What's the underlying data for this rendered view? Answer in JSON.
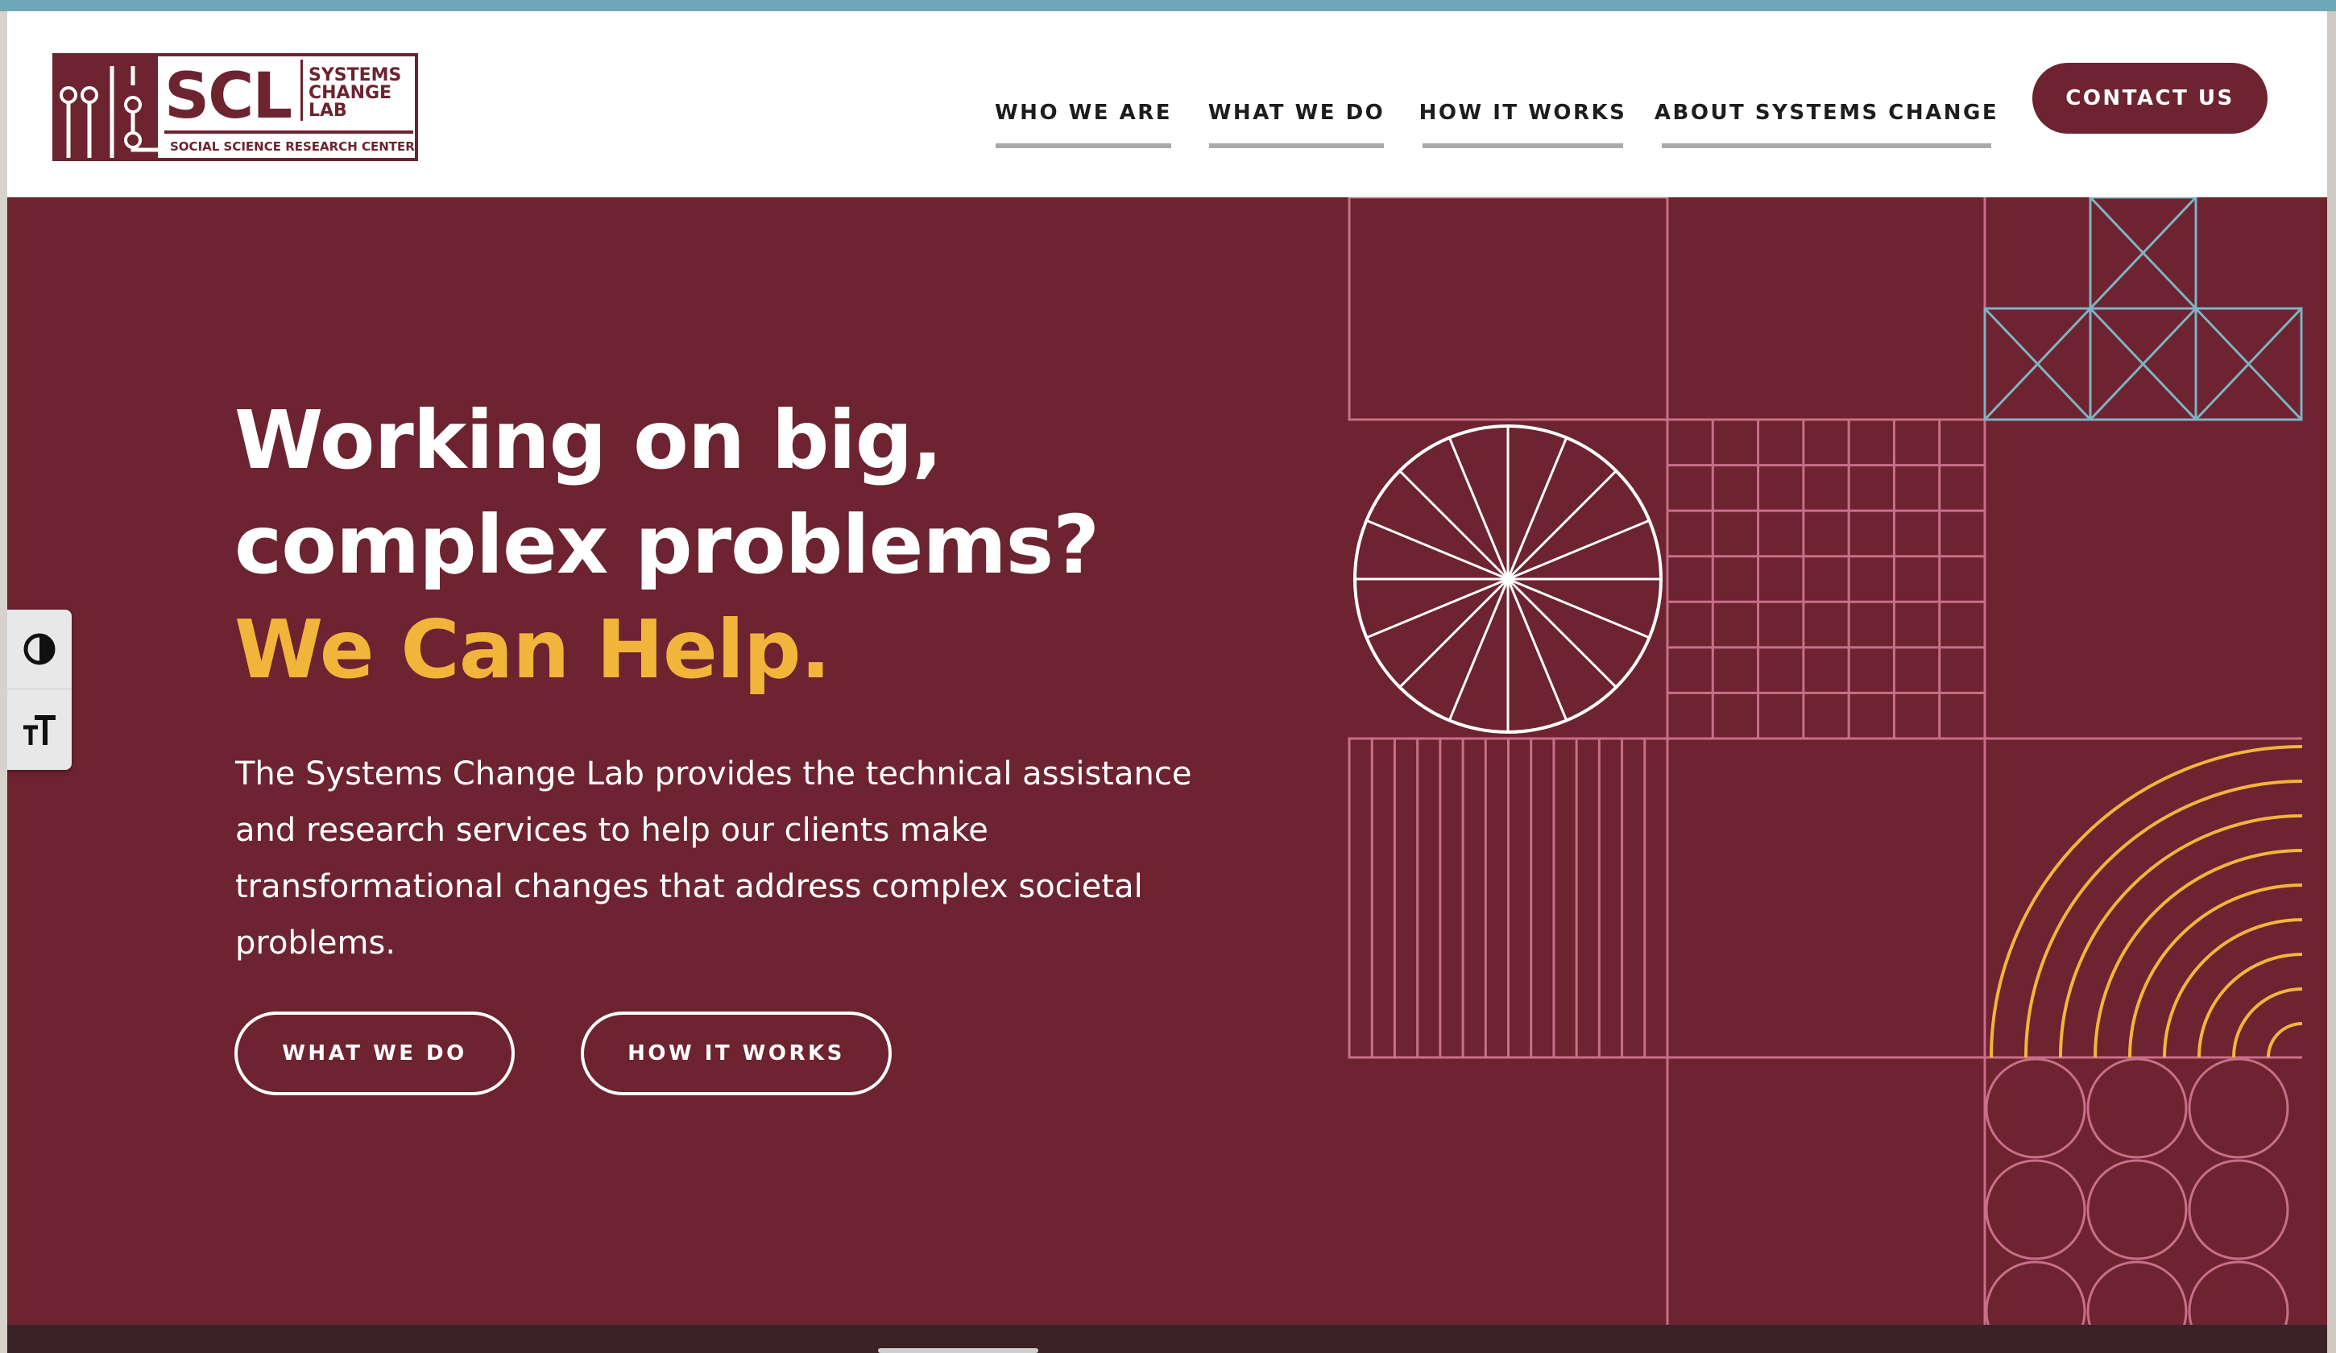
{
  "logo": {
    "wordmark": "SCL",
    "line1": "SYSTEMS",
    "line2": "CHANGE",
    "line3": "LAB",
    "subtitle": "SOCIAL SCIENCE RESEARCH CENTER"
  },
  "nav": {
    "items": [
      {
        "label": "WHO WE ARE"
      },
      {
        "label": "WHAT WE DO"
      },
      {
        "label": "HOW IT WORKS"
      },
      {
        "label": "ABOUT SYSTEMS CHANGE"
      }
    ],
    "contact_label": "CONTACT US"
  },
  "hero": {
    "title_line1": "Working on big,",
    "title_line2": "complex problems?",
    "title_accent": "We Can Help.",
    "body": "The Systems Change Lab provides the technical assistance and research services to help our clients make transformational changes that address complex societal problems.",
    "cta_primary": "WHAT WE DO",
    "cta_secondary": "HOW IT WORKS"
  },
  "accessibility": {
    "contrast_icon": "contrast-icon",
    "text_size_icon": "text-size-icon"
  },
  "colors": {
    "brand_maroon": "#6d2330",
    "accent_gold": "#f2b53c",
    "pattern_pink": "#c86f8a",
    "pattern_blue": "#7fb3c4",
    "top_strip": "#6fa8b6"
  }
}
